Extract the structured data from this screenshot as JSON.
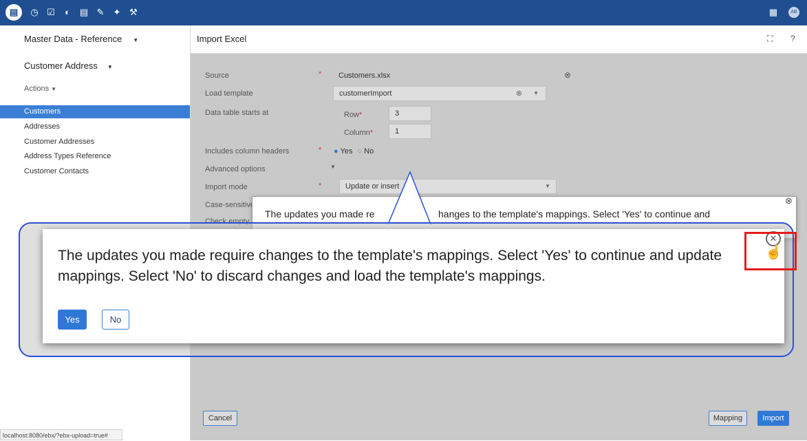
{
  "topbar": {
    "icons": [
      "database-icon",
      "clock-icon",
      "checklist-icon",
      "dashboard-icon",
      "data-list-icon",
      "task-icon",
      "plug-icon",
      "wrench-icon"
    ],
    "right_icons": [
      "panel-icon",
      "avatar-icon"
    ],
    "avatar_text": "AB"
  },
  "sidebar": {
    "dataspace": "Master Data - Reference",
    "table": "Customer Address",
    "actions": "Actions",
    "items": [
      {
        "label": "Customers",
        "active": true
      },
      {
        "label": "Addresses",
        "active": false
      },
      {
        "label": "Customer Addresses",
        "active": false
      },
      {
        "label": "Address Types Reference",
        "active": false
      },
      {
        "label": "Customer Contacts",
        "active": false
      }
    ]
  },
  "status_url": "localhost:8080/ebx/?ebx-upload=true#",
  "main": {
    "title": "Import Excel",
    "fullscreen_icon": "fullscreen-icon",
    "help": "?",
    "form": {
      "source_label": "Source",
      "source_value": "Customers.xlsx",
      "load_template_label": "Load template",
      "load_template_value": "customerImport",
      "table_start_label": "Data table starts at",
      "row_label": "Row",
      "row_value": "3",
      "column_label": "Column",
      "column_value": "1",
      "headers_label": "Includes column headers",
      "yes": "Yes",
      "no": "No",
      "advanced_label": "Advanced options",
      "import_mode_label": "Import mode",
      "import_mode_value": "Update or insert",
      "case_label": "Case-sensitive",
      "check_label": "Check empty"
    },
    "footer": {
      "cancel": "Cancel",
      "mapping": "Mapping",
      "import": "Import"
    }
  },
  "dialog": {
    "message": "The updates you made require changes to the template's mappings. Select 'Yes' to continue and update mappings. Select 'No' to discard changes and load the template's mappings.",
    "small_left": "The updates you made re",
    "small_right": "hanges to the template's mappings. Select 'Yes' to continue and",
    "yes": "Yes",
    "no": "No"
  },
  "colors": {
    "brand": "#1f4f91",
    "accent": "#2f78d6",
    "highlight": "#e51c1c",
    "zoom_frame": "#2a4fd6"
  }
}
